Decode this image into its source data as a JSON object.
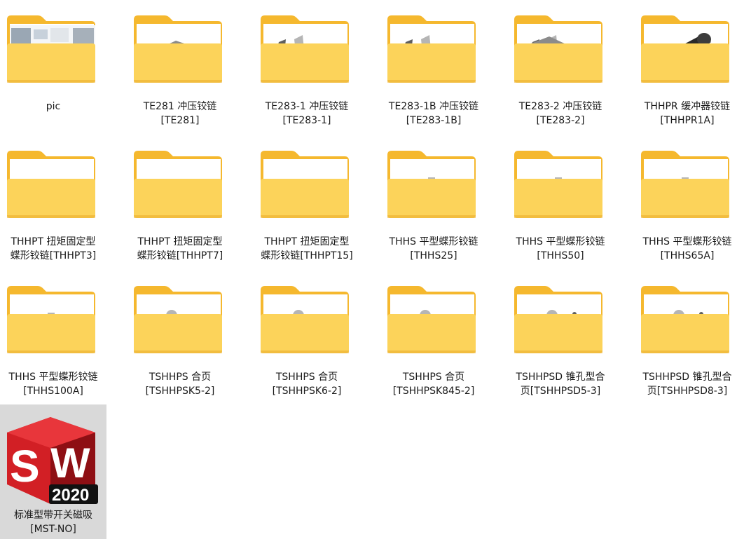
{
  "window": {
    "view": "large-icons"
  },
  "folders": [
    {
      "lines": [
        "pic"
      ],
      "thumb": "pic-collage"
    },
    {
      "lines": [
        "TE281 冲压铰链",
        "[TE281]"
      ],
      "thumb": "plate-hinge"
    },
    {
      "lines": [
        "TE283-1 冲压铰链",
        "[TE283-1]"
      ],
      "thumb": "bracket-hinge"
    },
    {
      "lines": [
        "TE283-1B 冲压铰链",
        "[TE283-1B]"
      ],
      "thumb": "bracket-hinge"
    },
    {
      "lines": [
        "TE283-2 冲压铰链",
        "[TE283-2]"
      ],
      "thumb": "bracket-hinge-2"
    },
    {
      "lines": [
        "THHPR 缓冲器铰链",
        "[THHPR1A]"
      ],
      "thumb": "damper-hinge"
    },
    {
      "lines": [
        "THHPT 扭矩固定型",
        "蝶形铰链[THHPT3]"
      ],
      "thumb": "butterfly-hinge"
    },
    {
      "lines": [
        "THHPT 扭矩固定型",
        "蝶形铰链[THHPT7]"
      ],
      "thumb": "butterfly-hinge"
    },
    {
      "lines": [
        "THHPT 扭矩固定型",
        "蝶形铰链[THHPT15]"
      ],
      "thumb": "butterfly-hinge"
    },
    {
      "lines": [
        "THHS 平型蝶形铰链",
        "[THHS25]"
      ],
      "thumb": "flat-hinge"
    },
    {
      "lines": [
        "THHS 平型蝶形铰链",
        "[THHS50]"
      ],
      "thumb": "flat-hinge"
    },
    {
      "lines": [
        "THHS 平型蝶形铰链",
        "[THHS65A]"
      ],
      "thumb": "flat-hinge"
    },
    {
      "lines": [
        "THHS 平型蝶形铰链",
        "[THHS100A]"
      ],
      "thumb": "flat-hinge-holes"
    },
    {
      "lines": [
        "TSHHPS 合页",
        "[TSHHPSK5-2]"
      ],
      "thumb": "round-hinge"
    },
    {
      "lines": [
        "TSHHPS 合页",
        "[TSHHPSK6-2]"
      ],
      "thumb": "round-hinge"
    },
    {
      "lines": [
        "TSHHPS 合页",
        "[TSHHPSK845-2]"
      ],
      "thumb": "round-hinge"
    },
    {
      "lines": [
        "TSHHPSD 锥孔型合",
        "页[TSHHPSD5-3]"
      ],
      "thumb": "countersunk-hinge"
    },
    {
      "lines": [
        "TSHHPSD 锥孔型合",
        "页[TSHHPSD8-3]"
      ],
      "thumb": "countersunk-hinge"
    }
  ],
  "file": {
    "lines": [
      "标准型带开关磁吸",
      "[MST-NO]"
    ],
    "icon": "solidworks-2020-icon",
    "badge_letters": [
      "S",
      "W"
    ],
    "badge_year": "2020",
    "colors": {
      "red": "#d21f25",
      "dark_red": "#8e0f14",
      "year_bg": "#111111"
    }
  },
  "colors": {
    "folder_back": "#f5b82e",
    "folder_front": "#fcd35a",
    "folder_edge": "#e8a723",
    "selected_bg": "#d9d9d9",
    "text": "#1a1a1a"
  }
}
